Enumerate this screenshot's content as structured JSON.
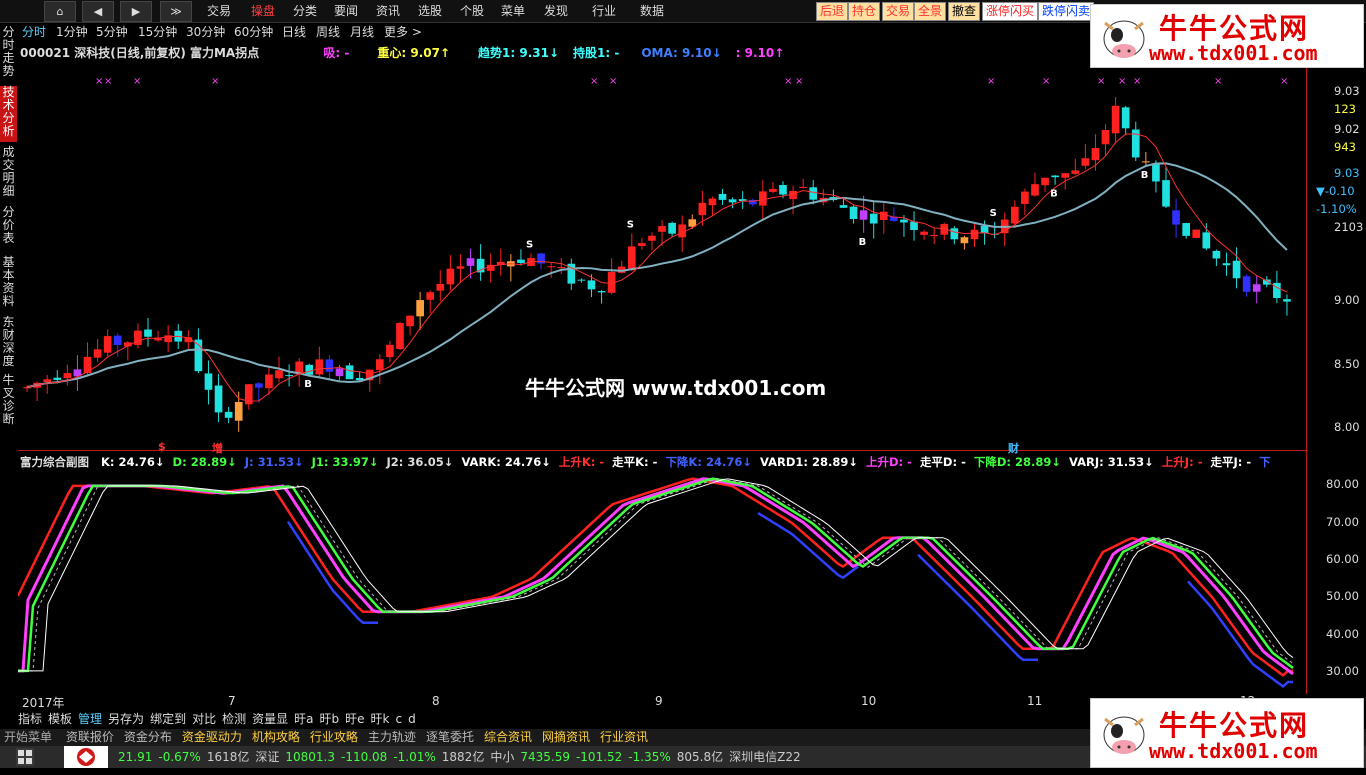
{
  "topbar": {
    "nav": [
      "⌂",
      "◀",
      "▶",
      "≫"
    ],
    "menus": [
      "交易",
      "操盘",
      "分类",
      "要闻",
      "资讯",
      "选股",
      "个股",
      "菜单",
      "发现",
      "行业",
      "数据"
    ],
    "active_menu_index": 1,
    "right_buttons": [
      {
        "label": "后退",
        "color": "#ff3030",
        "bg": "#ffe0a0"
      },
      {
        "label": "持仓",
        "color": "#ff3030",
        "bg": "#ffe0a0"
      },
      {
        "label": "交易",
        "color": "#ff3030",
        "bg": "#ffe0a0"
      },
      {
        "label": "全景",
        "color": "#ff3030",
        "bg": "#ffe0a0"
      },
      {
        "label": "撤查",
        "color": "#000000",
        "bg": "#ffe0a0"
      },
      {
        "label": "涨停闪买",
        "color": "#ff2020",
        "bg": "#ffffff"
      },
      {
        "label": "跌停闪卖",
        "color": "#0040ff",
        "bg": "#ffffff"
      }
    ]
  },
  "periods": [
    "分时",
    "1分钟",
    "5分钟",
    "15分钟",
    "30分钟",
    "60分钟",
    "日线",
    "周线",
    "月线",
    "更多 >"
  ],
  "active_period_index": 0,
  "left_tabs": [
    {
      "label": "分时走势",
      "active": false
    },
    {
      "label": "技术分析",
      "active": true
    },
    {
      "label": "成交明细",
      "active": false
    },
    {
      "label": "分价表",
      "active": false
    },
    {
      "label": "基本资料",
      "active": false
    },
    {
      "label": "东财深度",
      "active": false
    },
    {
      "label": "牛叉诊断",
      "active": false
    }
  ],
  "info": {
    "title": "000021 深科技(日线,前复权) 富力MA拐点",
    "items": [
      {
        "text": "吸: -",
        "color": "#ff40ff"
      },
      {
        "text": "重心: 9.07↑",
        "color": "#ffff40"
      },
      {
        "text": "趋势1: 9.31↓",
        "color": "#40ffff"
      },
      {
        "text": "持股1: -",
        "color": "#40ffff"
      },
      {
        "text": "OMA: 9.10↓",
        "color": "#4080ff"
      },
      {
        "text": ": 9.10↑",
        "color": "#ff40ff"
      }
    ]
  },
  "price_axis": [
    {
      "text": "9.03",
      "color": "#dddddd"
    },
    {
      "text": "123",
      "color": "#ffff40"
    },
    {
      "text": "9.02",
      "color": "#dddddd"
    },
    {
      "text": "943",
      "color": "#ffff40"
    },
    {
      "text": "9.03",
      "color": "#40c0ff"
    },
    {
      "text": "▼-0.10",
      "color": "#40c0ff"
    },
    {
      "text": "-1.10%",
      "color": "#40c0ff"
    },
    {
      "text": "2103",
      "color": "#dddddd"
    },
    {
      "text": "9.00",
      "color": "#dddddd"
    },
    {
      "text": "8.50",
      "color": "#dddddd"
    },
    {
      "text": "8.00",
      "color": "#dddddd"
    }
  ],
  "watermark": "牛牛公式网  www.tdx001.com",
  "signals": {
    "B": "B",
    "S": "S",
    "top_mark": "×",
    "sub_s": "$",
    "sub_zeng": "增",
    "sub_cai": "财"
  },
  "subchart": {
    "title": "富力综合副图",
    "items": [
      {
        "text": "K: 24.76↓",
        "color": "#ffffff"
      },
      {
        "text": "D: 28.89↓",
        "color": "#40ff40"
      },
      {
        "text": "J: 31.53↓",
        "color": "#4060ff"
      },
      {
        "text": "J1: 33.97↓",
        "color": "#40ff40"
      },
      {
        "text": "J2: 36.05↓",
        "color": "#dddddd"
      },
      {
        "text": "VARK: 24.76↓",
        "color": "#ffffff"
      },
      {
        "text": "上升K: -",
        "color": "#ff3030"
      },
      {
        "text": "走平K: -",
        "color": "#ffffff"
      },
      {
        "text": "下降K: 24.76↓",
        "color": "#4060ff"
      },
      {
        "text": "VARD1: 28.89↓",
        "color": "#ffffff"
      },
      {
        "text": "上升D: -",
        "color": "#ff40ff"
      },
      {
        "text": "走平D: -",
        "color": "#ffffff"
      },
      {
        "text": "下降D: 28.89↓",
        "color": "#40ff40"
      },
      {
        "text": "VARJ: 31.53↓",
        "color": "#ffffff"
      },
      {
        "text": "上升J: -",
        "color": "#ff3030"
      },
      {
        "text": "走平J: -",
        "color": "#ffffff"
      },
      {
        "text": "下",
        "color": "#4060ff"
      }
    ],
    "axis": [
      "80.00",
      "70.00",
      "60.00",
      "50.00",
      "40.00",
      "30.00"
    ]
  },
  "date_axis": [
    "2017年",
    "7",
    "8",
    "9",
    "10",
    "11",
    "12"
  ],
  "bottom_tools": [
    "指标",
    "模板",
    "管理",
    "另存为",
    "绑定到",
    "对比",
    "检测",
    "资量显",
    "旴a",
    "旴b",
    "旴e",
    "旴k",
    "c",
    "d"
  ],
  "ticker": {
    "left": "开始菜单",
    "items": [
      "资联报价",
      "资金分布",
      "资金驱动力",
      "机构攻略",
      "行业攻略",
      "主力轨迹",
      "逐笔委托",
      "综合资讯",
      "网摘资讯",
      "行业资讯"
    ]
  },
  "status": {
    "items": [
      {
        "text": "21.91",
        "color": "#40ff40"
      },
      {
        "text": "-0.67%",
        "color": "#40ff40"
      },
      {
        "text": "1618亿",
        "color": "#cccccc"
      },
      {
        "text": "深证",
        "color": "#cccccc"
      },
      {
        "text": "10801.3",
        "color": "#40ff40"
      },
      {
        "text": "-110.08",
        "color": "#40ff40"
      },
      {
        "text": "-1.01%",
        "color": "#40ff40"
      },
      {
        "text": "1882亿",
        "color": "#cccccc"
      },
      {
        "text": "中小",
        "color": "#cccccc"
      },
      {
        "text": "7435.59",
        "color": "#40ff40"
      },
      {
        "text": "-101.52",
        "color": "#40ff40"
      },
      {
        "text": "-1.35%",
        "color": "#40ff40"
      },
      {
        "text": "805.8亿",
        "color": "#cccccc"
      },
      {
        "text": "深圳电信Z22",
        "color": "#cccccc"
      }
    ]
  },
  "ad": {
    "title": "牛牛公式网",
    "url": "www.tdx001.com"
  },
  "colors": {
    "up": "#ff2020",
    "down": "#20e0e0",
    "blue": "#3030ff",
    "orange": "#ffa040",
    "magenta": "#c040ff",
    "ma": "#80b0c0"
  }
}
